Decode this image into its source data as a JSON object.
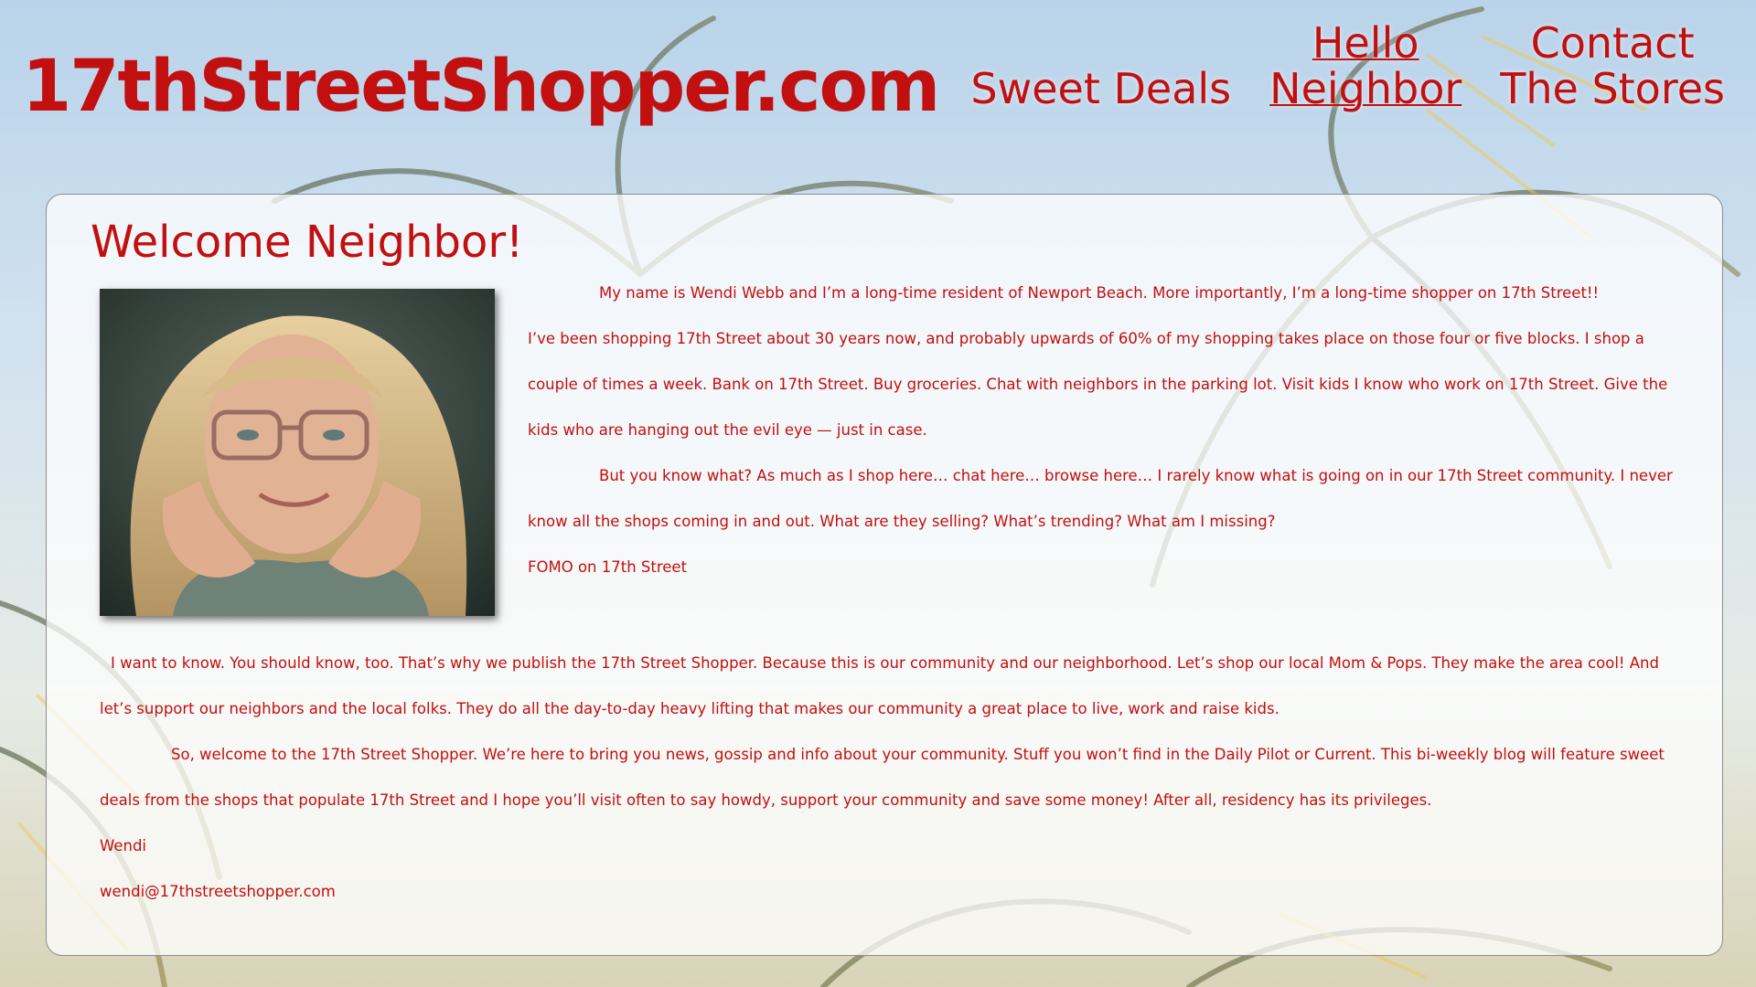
{
  "site": {
    "title": "17thStreetShopper.com"
  },
  "nav": {
    "items": [
      {
        "line1": "",
        "line2": "Sweet Deals",
        "active": false
      },
      {
        "line1": "Hello",
        "line2": "Neighbor",
        "active": true
      },
      {
        "line1": "Contact",
        "line2": "The Stores",
        "active": false
      }
    ]
  },
  "main": {
    "heading": "Welcome Neighbor!",
    "paragraphs": [
      "My name is Wendi Webb and I’m a long-time resident of Newport Beach. More importantly, I’m a long-time shopper on 17th Street!!",
      "I’ve been shopping 17th Street about 30 years now, and probably upwards of 60% of my shopping takes place on those four or five blocks. I shop a couple of times a week. Bank on 17th Street. Buy groceries. Chat with neighbors in the parking lot. Visit kids I know who work on 17th Street. Give the kids who are hanging out the evil eye — just in case.",
      "But you know what? As much as I shop here… chat here… browse here… I rarely know what is going on in our 17th Street community. I never know all the shops coming in and out. What are they selling? What’s trending? What am I missing?",
      "FOMO on 17th Street",
      "I want to know. You should know, too. That’s why we publish the 17th Street Shopper. Because this is our community and our neighborhood. Let’s shop our local Mom & Pops. They make the area cool! And let’s support our neighbors and the local folks. They do all the day-to-day heavy lifting that makes our community a great place to live, work and raise kids.",
      "So, welcome to the 17th Street Shopper. We’re here to bring you news, gossip and info about your community. Stuff you won’t find in the Daily Pilot or Current. This bi-weekly blog will feature sweet deals from the shops that populate 17th Street and I hope you’ll visit often to say howdy, support your community and save some money! After all, residency has its privileges.",
      "Wendi",
      "wendi@17thstreetshopper.com"
    ]
  },
  "colors": {
    "accent": "#c20f0f",
    "panel_bg": "rgba(255,255,255,0.74)"
  },
  "images": {
    "portrait": "portrait-photo"
  }
}
